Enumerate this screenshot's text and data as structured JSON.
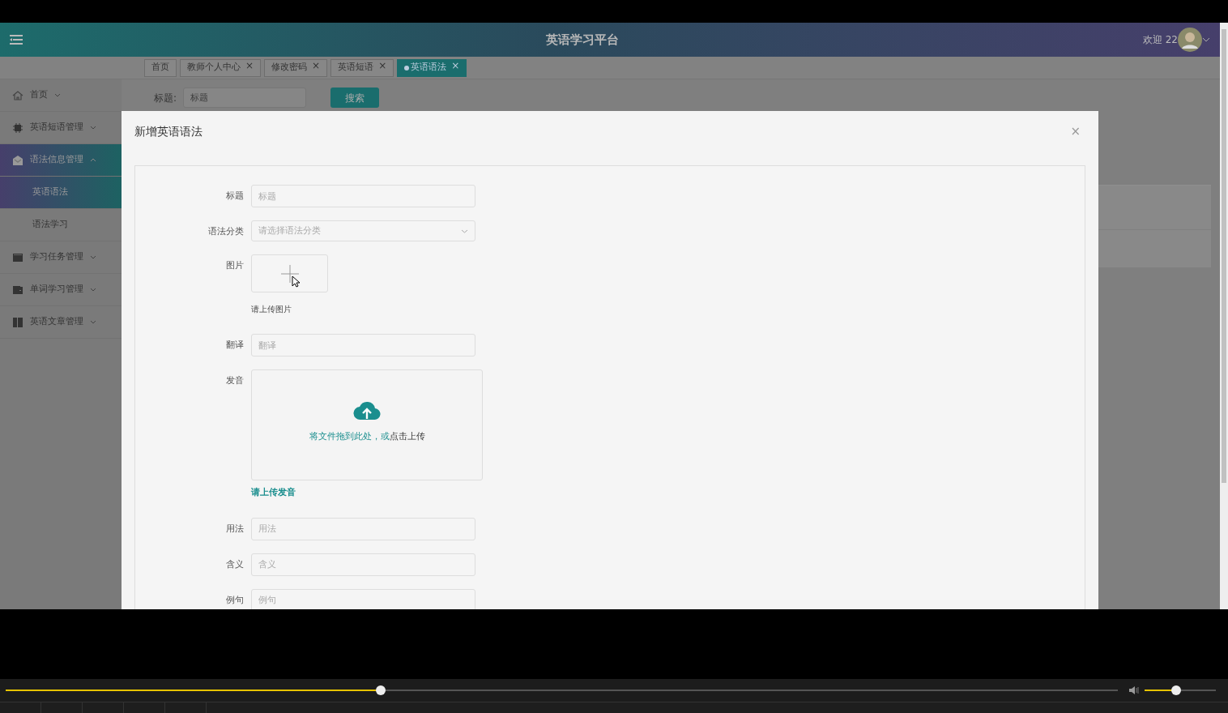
{
  "header": {
    "title": "英语学习平台",
    "welcome": "欢迎 22"
  },
  "tabs": [
    {
      "label": "首页",
      "selected": false
    },
    {
      "label": "教师个人中心",
      "close": "×",
      "selected": false
    },
    {
      "label": "修改密码",
      "close": "×",
      "selected": false
    },
    {
      "label": "英语短语",
      "close": "×",
      "selected": false
    },
    {
      "label": "英语语法",
      "close": "×",
      "selected": true
    }
  ],
  "sidebar": {
    "items": [
      {
        "label": "首页",
        "kind": "home",
        "expanded": false,
        "selected": false
      },
      {
        "label": "英语短语管理",
        "kind": "chip",
        "expanded": false,
        "selected": false
      },
      {
        "label": "语法信息管理",
        "kind": "mail",
        "expanded": true,
        "selected": true,
        "children": [
          {
            "label": "英语语法",
            "selected": true
          },
          {
            "label": "语法学习",
            "selected": false
          }
        ]
      },
      {
        "label": "学习任务管理",
        "kind": "panel",
        "expanded": false,
        "selected": false
      },
      {
        "label": "单词学习管理",
        "kind": "wallet",
        "expanded": false,
        "selected": false
      },
      {
        "label": "英语文章管理",
        "kind": "book",
        "expanded": false,
        "selected": false
      }
    ]
  },
  "search": {
    "label": "标题:",
    "placeholder": "标题",
    "button": "搜索"
  },
  "modal": {
    "title": "新增英语语法",
    "close": "×",
    "fields": [
      {
        "kind": "input",
        "label": "标题",
        "placeholder": "标题"
      },
      {
        "kind": "select",
        "label": "语法分类",
        "placeholder": "请选择语法分类"
      },
      {
        "kind": "image-upload",
        "label": "图片",
        "hint": "请上传图片"
      },
      {
        "kind": "input",
        "label": "翻译",
        "placeholder": "翻译"
      },
      {
        "kind": "file-upload",
        "label": "发音",
        "drop_text": "将文件拖到此处，或",
        "click_text": "点击上传",
        "hint": "请上传发音"
      },
      {
        "kind": "input",
        "label": "用法",
        "placeholder": "用法"
      },
      {
        "kind": "input",
        "label": "含义",
        "placeholder": "含义"
      },
      {
        "kind": "input",
        "label": "例句",
        "placeholder": "例句"
      }
    ]
  },
  "player": {
    "progress": {
      "level": 0.337
    },
    "volume": {
      "level": 0.44
    }
  }
}
